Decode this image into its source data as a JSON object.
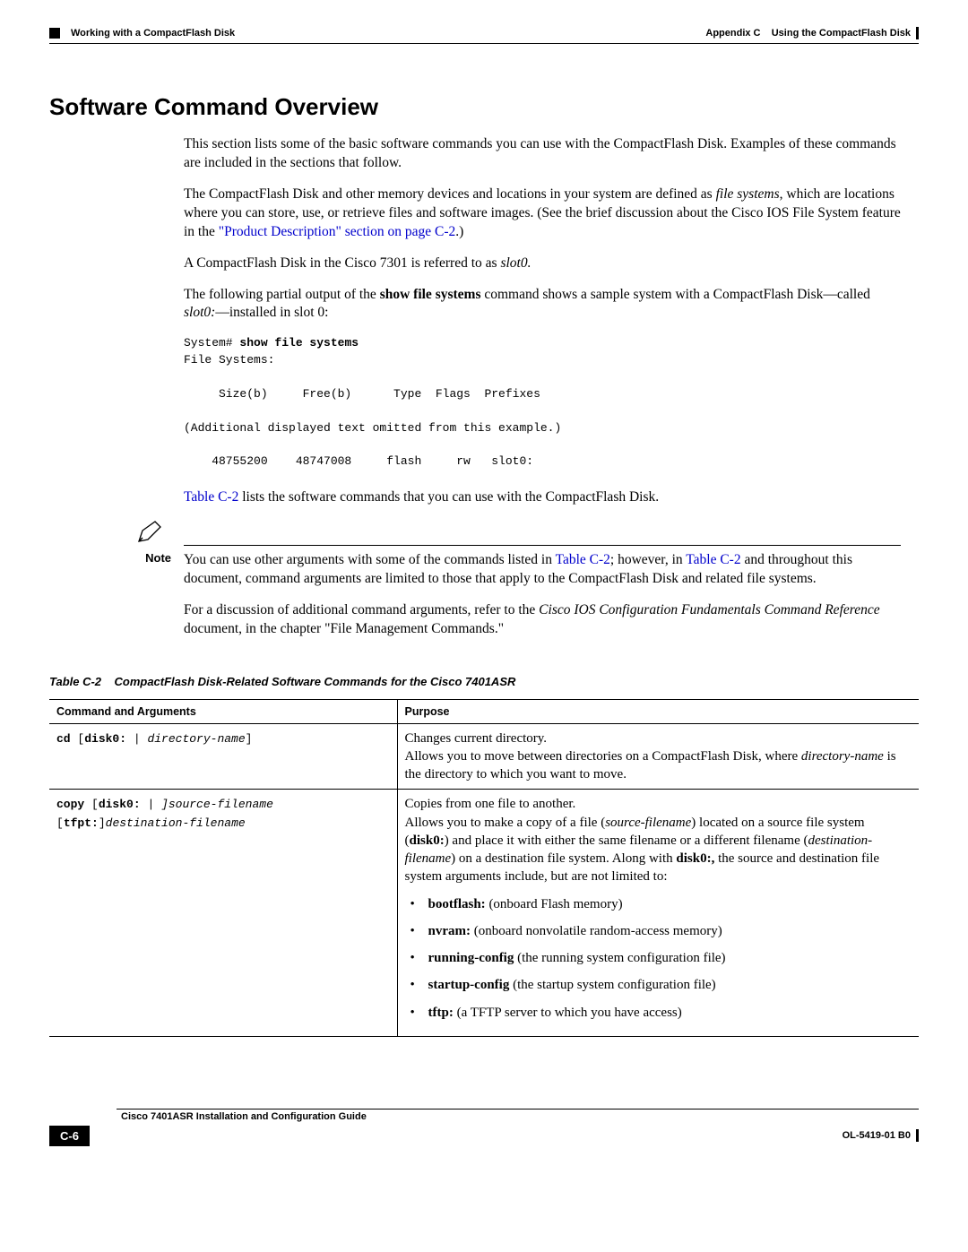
{
  "header": {
    "appendix": "Appendix C",
    "appendix_title": "Using the CompactFlash Disk",
    "section_path": "Working with a CompactFlash Disk"
  },
  "title": "Software Command Overview",
  "paragraphs": {
    "p1": "This section lists some of the basic software commands you can use with the CompactFlash Disk. Examples of these commands are included in the sections that follow.",
    "p2a": "The CompactFlash Disk and other memory devices and locations in your system are defined as ",
    "p2b_italic": "file systems",
    "p2c": ", which are locations where you can store, use, or retrieve files and software images. (See the brief discussion about the Cisco IOS File System feature in the ",
    "p2_link": "\"Product Description\" section on page C-2",
    "p2d": ".)",
    "p3a": "A CompactFlash Disk in the Cisco 7301 is referred to as ",
    "p3b_italic": "slot0.",
    "p4a": "The following partial output of the ",
    "p4b_bold": "show file systems",
    "p4c": " command shows a sample system with a CompactFlash Disk—called ",
    "p4d_italic": "slot0:",
    "p4e": "—installed in slot 0:",
    "console_prompt": "System# ",
    "console_cmd": "show file systems",
    "console_rest": "File Systems:\n\n     Size(b)     Free(b)      Type  Flags  Prefixes\n\n(Additional displayed text omitted from this example.)\n\n    48755200    48747008     flash     rw   slot0:",
    "p5_link": "Table C-2",
    "p5_rest": " lists the software commands that you can use with the CompactFlash Disk.",
    "note_label": "Note",
    "note_a": "You can use other arguments with some of the commands listed in ",
    "note_link1": "Table C-2",
    "note_b": "; however, in ",
    "note_link2": "Table C-2",
    "note_c": " and throughout this document, command arguments are limited to those that apply to the CompactFlash Disk and related file systems.",
    "p6a": "For a discussion of additional command arguments, refer to the ",
    "p6b_italic": "Cisco IOS Configuration Fundamentals Command Reference",
    "p6c": " document, in the chapter \"File Management Commands.\""
  },
  "table": {
    "caption_id": "Table C-2",
    "caption_text": "CompactFlash Disk-Related Software Commands for the Cisco 7401ASR",
    "col1": "Command and Arguments",
    "col2": "Purpose",
    "rows": [
      {
        "cmd_prefix": "cd ",
        "cmd_bracket_l": "[",
        "cmd_disk": "disk0: ",
        "cmd_pipe": "| ",
        "cmd_arg_italic": "directory-name",
        "cmd_bracket_r": "]",
        "purpose_lead": "Changes current directory.",
        "purpose_body_a": "Allows you to move between directories on a CompactFlash Disk, where ",
        "purpose_body_b_italic": "directory-name",
        "purpose_body_c": " is the directory to which you want to move."
      },
      {
        "cmd_prefix": "copy ",
        "cmd_bracket_l": "[",
        "cmd_disk": "disk0: ",
        "cmd_pipe": "| ",
        "cmd_arg1_italic": "]source-filename",
        "cmd_line2_a": "[",
        "cmd_line2_b": "tfpt:",
        "cmd_line2_c": "]",
        "cmd_line2_d_italic": "destination-filename",
        "purpose_lead": "Copies from one file to another.",
        "purpose_body_a": "Allows you to make a copy of a file (",
        "purpose_body_b_italic": "source-filename",
        "purpose_body_c": ") located on a source file system (",
        "purpose_body_d_bold": "disk0:",
        "purpose_body_e": ") and place it with either the same filename or a different filename (",
        "purpose_body_f_italic": "destination-filename",
        "purpose_body_g": ") on a destination file system. Along with ",
        "purpose_body_h_bold": "disk0:,",
        "purpose_body_i": " the source and destination file system arguments include, but are not limited to:",
        "dests": [
          {
            "b": "bootflash:",
            "rest": " (onboard Flash memory)"
          },
          {
            "b": "nvram:",
            "rest": " (onboard nonvolatile random-access memory)"
          },
          {
            "b": "running-config",
            "rest": " (the running system configuration file)"
          },
          {
            "b": "startup-config",
            "rest": " (the startup system configuration file)"
          },
          {
            "b": "tftp:",
            "rest": " (a TFTP server to which you have access)"
          }
        ]
      }
    ]
  },
  "footer": {
    "guide_title": "Cisco 7401ASR Installation and Configuration Guide",
    "page_num": "C-6",
    "doc_id": "OL-5419-01 B0"
  }
}
